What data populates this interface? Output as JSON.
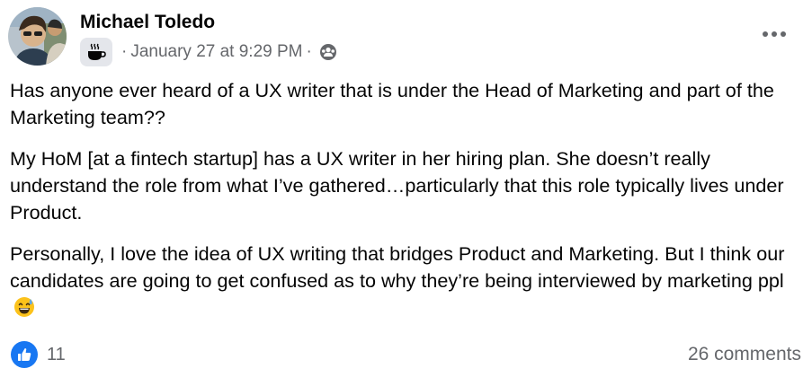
{
  "post": {
    "author": "Michael Toledo",
    "timestamp": "January 27 at 9:29 PM",
    "separator": "·",
    "paragraphs": [
      "Has anyone ever heard of a UX writer that is under the Head of Marketing and part of the Marketing team??",
      "My HoM [at a fintech startup] has a UX writer in her hiring plan. She doesn’t really understand the role from what I’ve gathered…particularly that this role typically lives under Product.",
      "Personally, I love the idea of UX writing that bridges Product and Marketing. But I think our candidates are going to get confused as to why they’re being interviewed by marketing ppl"
    ],
    "emoji": "grinning-sweat-face",
    "reaction_count": "11",
    "comments_label": "26 comments",
    "icons": {
      "badge": "coffee-cup-icon",
      "audience": "group-icon",
      "more": "more-options-icon",
      "like": "like-icon"
    },
    "colors": {
      "accent": "#1877f2",
      "secondary_text": "#65676b",
      "badge_bg": "#e4e6eb"
    }
  }
}
